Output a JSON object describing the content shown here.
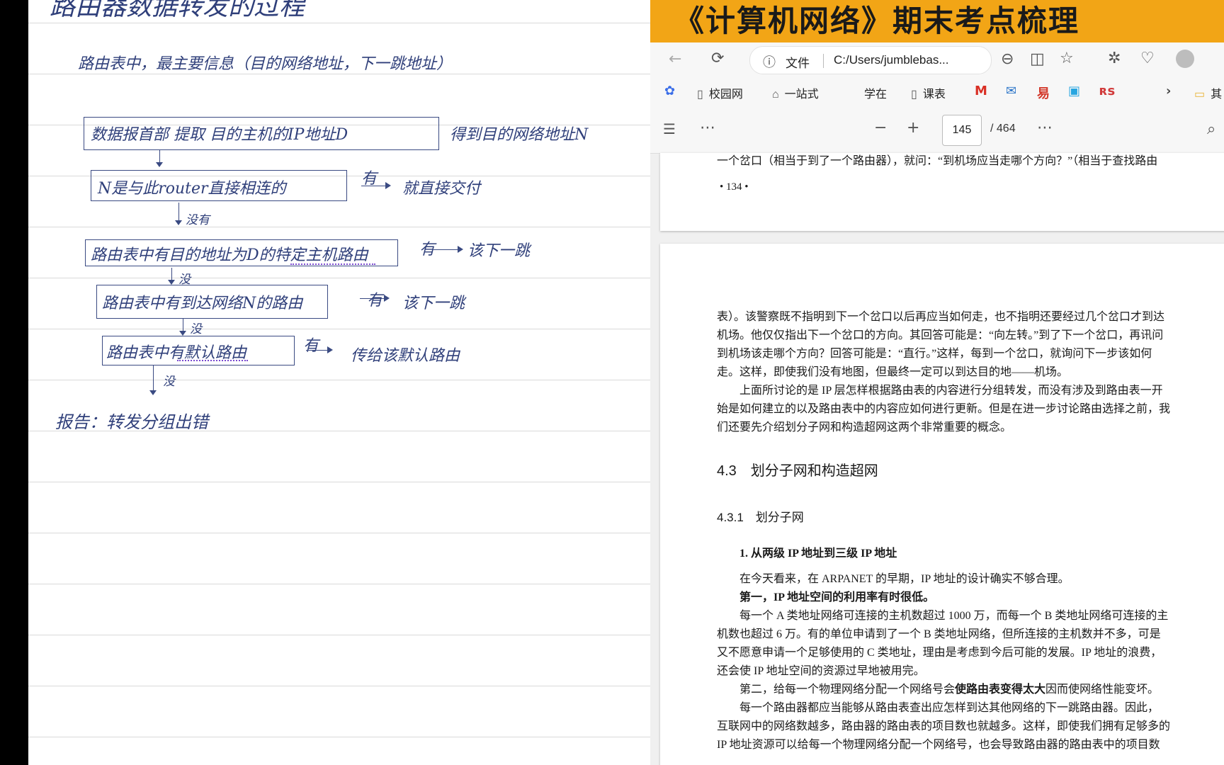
{
  "notes": {
    "title": "路由器数据转发的过程",
    "line1": "路由表中，最主要信息（目的网络地址，下一跳地址）",
    "step1_box": "数据报首部 提取 目的主机的IP地址D",
    "step1_right": "得到目的网络地址N",
    "step2_box": "N是与此router直接相连的",
    "step2_yes": "有",
    "step2_result": "就直接交付",
    "step2_no": "没有",
    "step3_box": "路由表中有目的地址为D的特定主机路由",
    "step3_yes": "有",
    "step3_result": "该下一跳",
    "step3_no": "没",
    "step4_box": "路由表中有到达网络N的路由",
    "step4_yes": "有",
    "step4_result": "该下一跳",
    "step4_no": "没",
    "step5_box": "路由表中有默认路由",
    "step5_yes": "有",
    "step5_result": "传给该默认路由",
    "step5_no": "没",
    "final": "报告：转发分组出错"
  },
  "banner": {
    "title": "《计算机网络》期末考点梳理"
  },
  "browser": {
    "back_icon": "back-arrow-icon",
    "file_label": "文件",
    "url": "C:/Users/jumblebas...",
    "bookmarks": [
      "校园网",
      "一站式",
      "学在",
      "课表"
    ],
    "bookmark_overflow": "其"
  },
  "pdf": {
    "page_number": "145",
    "page_total": "/ 464"
  },
  "page1": {
    "line1": "一个岔口（相当于到了一个路由器），就问：“到机场应当走哪个方向？”（相当于查找路由",
    "page_no": "• 134 •"
  },
  "page2": {
    "p1": [
      "表）。该警察既不指明到下一个岔口以后再应当如何走，也不指明还要经过几个岔口才到达",
      "机场。他仅仅指出下一个岔口的方向。其回答可能是：“向左转。”到了下一个岔口，再讯问",
      "到机场该走哪个方向？回答可能是：“直行。”这样，每到一个岔口，就询问下一步该如何",
      "走。这样，即使我们没有地图，但最终一定可以到达目的地——机场。"
    ],
    "p2": [
      "上面所讨论的是 IP 层怎样根据路由表的内容进行分组转发，而没有涉及到路由表一开",
      "始是如何建立的以及路由表中的内容应如何进行更新。但是在进一步讨论路由选择之前，我",
      "们还要先介绍划分子网和构造超网这两个非常重要的概念。"
    ],
    "section": "4.3　划分子网和构造超网",
    "subsection": "4.3.1　划分子网",
    "item1": "1. 从两级 IP 地址到三级 IP 地址",
    "p3": "在今天看来，在 ARPANET 的早期，IP 地址的设计确实不够合理。",
    "p4_bold": "第一，IP 地址空间的利用率有时很低。",
    "p5": [
      "每一个 A 类地址网络可连接的主机数超过 1000 万，而每一个 B 类地址网络可连接的主",
      "机数也超过 6 万。有的单位申请到了一个 B 类地址网络，但所连接的主机数并不多，可是",
      "又不愿意申请一个足够使用的 C 类地址，理由是考虑到今后可能的发展。IP 地址的浪费，",
      "还会使 IP 地址空间的资源过早地被用完。"
    ],
    "p6_pre": "第二，给每一个物理网络分配一个网络号会",
    "p6_bold": "使路由表变得太大",
    "p6_post": "因而使网络性能变坏。",
    "p7": [
      "每一个路由器都应当能够从路由表查出应怎样到达其他网络的下一跳路由器。因此，",
      "互联网中的网络数越多，路由器的路由表的项目数也就越多。这样，即使我们拥有足够多的",
      "IP 地址资源可以给每一个物理网络分配一个网络号，也会导致路由器的路由表中的项目数"
    ]
  }
}
